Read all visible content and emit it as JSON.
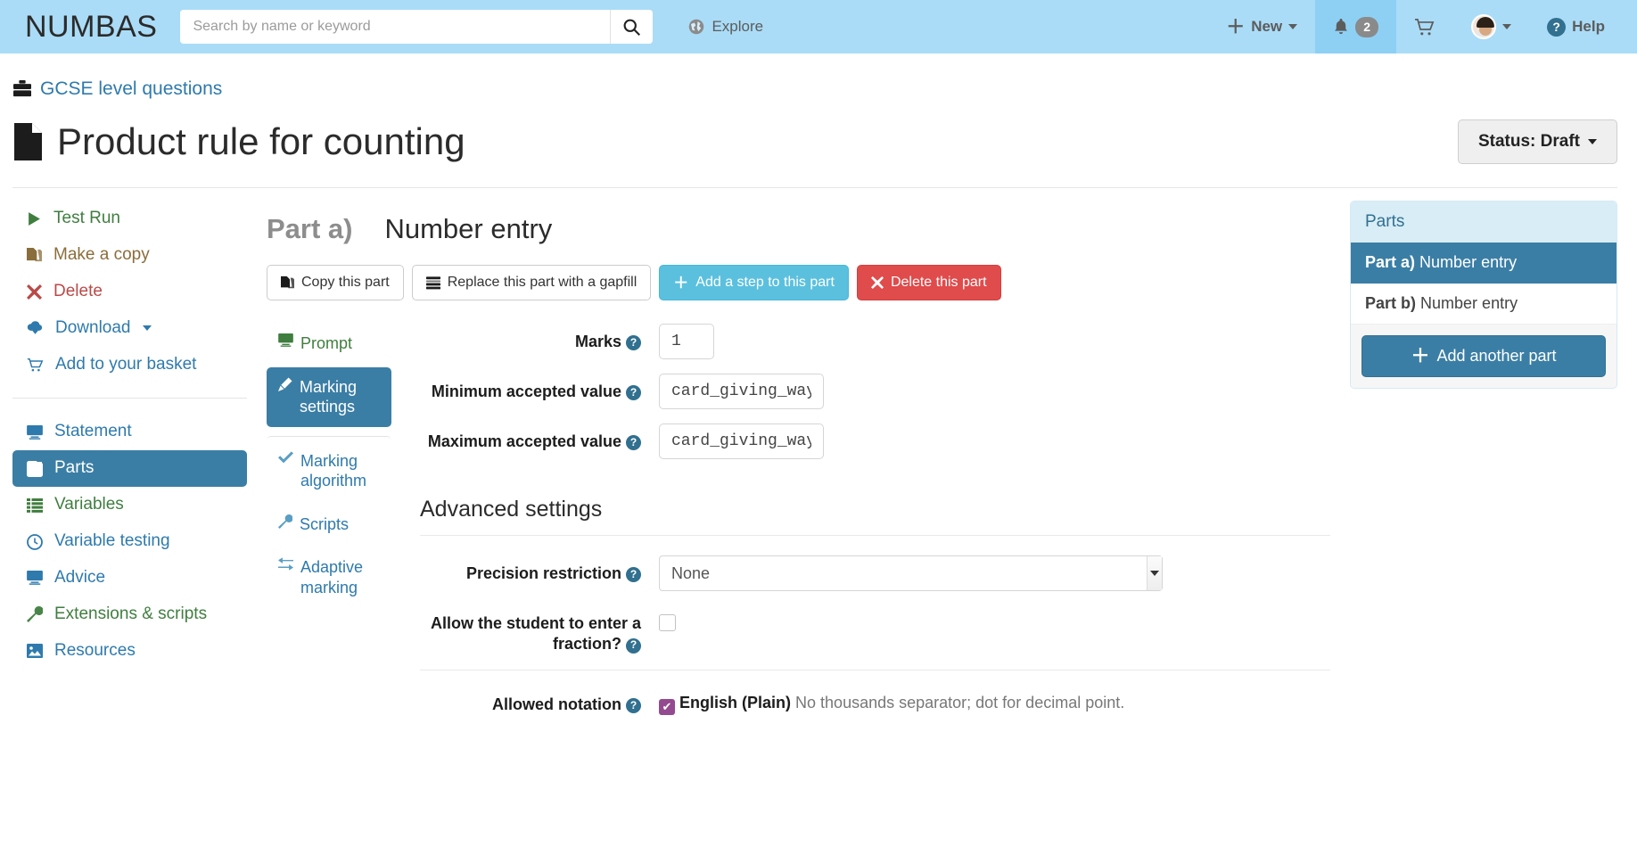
{
  "navbar": {
    "brand": "NUMBAS",
    "search_placeholder": "Search by name or keyword",
    "search_value": "",
    "search_icon": "search-icon",
    "explore_label": "Explore",
    "explore_icon": "globe-icon",
    "new_label": "New",
    "notifications_count": "2",
    "notifications_icon": "bell-icon",
    "basket_icon": "shopping-cart-icon",
    "avatar_icon": "user-avatar",
    "help_label": "Help",
    "help_icon": "question-circle-icon",
    "bg_color": "#aadcf7",
    "highlight_color": "#8ed0f4"
  },
  "header": {
    "breadcrumb_label": "GCSE level questions",
    "breadcrumb_icon": "briefcase-icon",
    "title": "Product rule for counting",
    "title_icon": "document-icon",
    "status_label": "Status: Draft"
  },
  "sidebar": {
    "group1": [
      {
        "label": "Test Run",
        "icon": "play-icon",
        "color": "c-green"
      },
      {
        "label": "Make a copy",
        "icon": "copy-icon",
        "color": "c-gold"
      },
      {
        "label": "Delete",
        "icon": "times-icon",
        "color": "c-red"
      },
      {
        "label": "Download",
        "icon": "cloud-download-icon",
        "color": "c-blue",
        "caret": true
      },
      {
        "label": "Add to your basket",
        "icon": "shopping-cart-icon",
        "color": "c-blue"
      }
    ],
    "group2": [
      {
        "label": "Statement",
        "icon": "desktop-icon",
        "color": "c-blue",
        "active": false
      },
      {
        "label": "Parts",
        "icon": "check-square-icon",
        "color": "c-white",
        "active": true
      },
      {
        "label": "Variables",
        "icon": "list-icon",
        "color": "c-green",
        "active": false
      },
      {
        "label": "Variable testing",
        "icon": "clock-icon",
        "color": "c-blue",
        "active": false
      },
      {
        "label": "Advice",
        "icon": "desktop-icon",
        "color": "c-blue",
        "active": false
      },
      {
        "label": "Extensions & scripts",
        "icon": "wrench-icon",
        "color": "c-green",
        "active": false
      },
      {
        "label": "Resources",
        "icon": "image-icon",
        "color": "c-blue",
        "active": false
      }
    ]
  },
  "part": {
    "label": "Part a)",
    "type": "Number entry",
    "buttons": [
      {
        "label": "Copy this part",
        "icon": "copy-icon",
        "style": "btn-default"
      },
      {
        "label": "Replace this part with a gapfill",
        "icon": "gapfill-icon",
        "style": "btn-default"
      },
      {
        "label": "Add a step to this part",
        "icon": "plus-icon",
        "style": "btn-info"
      },
      {
        "label": "Delete this part",
        "icon": "times-icon",
        "style": "btn-danger"
      }
    ],
    "tabs": [
      {
        "label": "Prompt",
        "icon": "desktop-icon",
        "color": "c-green",
        "active": false,
        "sep": false
      },
      {
        "label": "Marking settings",
        "icon": "pencil-icon",
        "color": "c-white",
        "active": true,
        "sep": false
      },
      {
        "label": "Marking algorithm",
        "icon": "check-icon",
        "color": "c-blue",
        "active": false,
        "sep": true
      },
      {
        "label": "Scripts",
        "icon": "wrench-icon",
        "color": "c-blue",
        "active": false,
        "sep": false
      },
      {
        "label": "Adaptive marking",
        "icon": "exchange-icon",
        "color": "c-blue",
        "active": false,
        "sep": false
      }
    ]
  },
  "form": {
    "marks_label": "Marks",
    "marks_value": "1",
    "min_label": "Minimum accepted value",
    "min_value": "card_giving_ways",
    "max_label": "Maximum accepted value",
    "max_value": "card_giving_ways",
    "advanced_title": "Advanced settings",
    "precision_label": "Precision restriction",
    "precision_value": "None",
    "fraction_label": "Allow the student to enter a fraction?",
    "fraction_checked": false,
    "notation_label": "Allowed notation",
    "notation_option_name": "English (Plain)",
    "notation_option_desc": "No thousands separator; dot for decimal point.",
    "notation_checked": true,
    "help_glyph": "?"
  },
  "parts_panel": {
    "title": "Parts",
    "items": [
      {
        "prefix": "Part a)",
        "name": "Number entry",
        "active": true
      },
      {
        "prefix": "Part b)",
        "name": "Number entry",
        "active": false
      }
    ],
    "add_label": "Add another part",
    "add_icon": "plus-icon"
  }
}
